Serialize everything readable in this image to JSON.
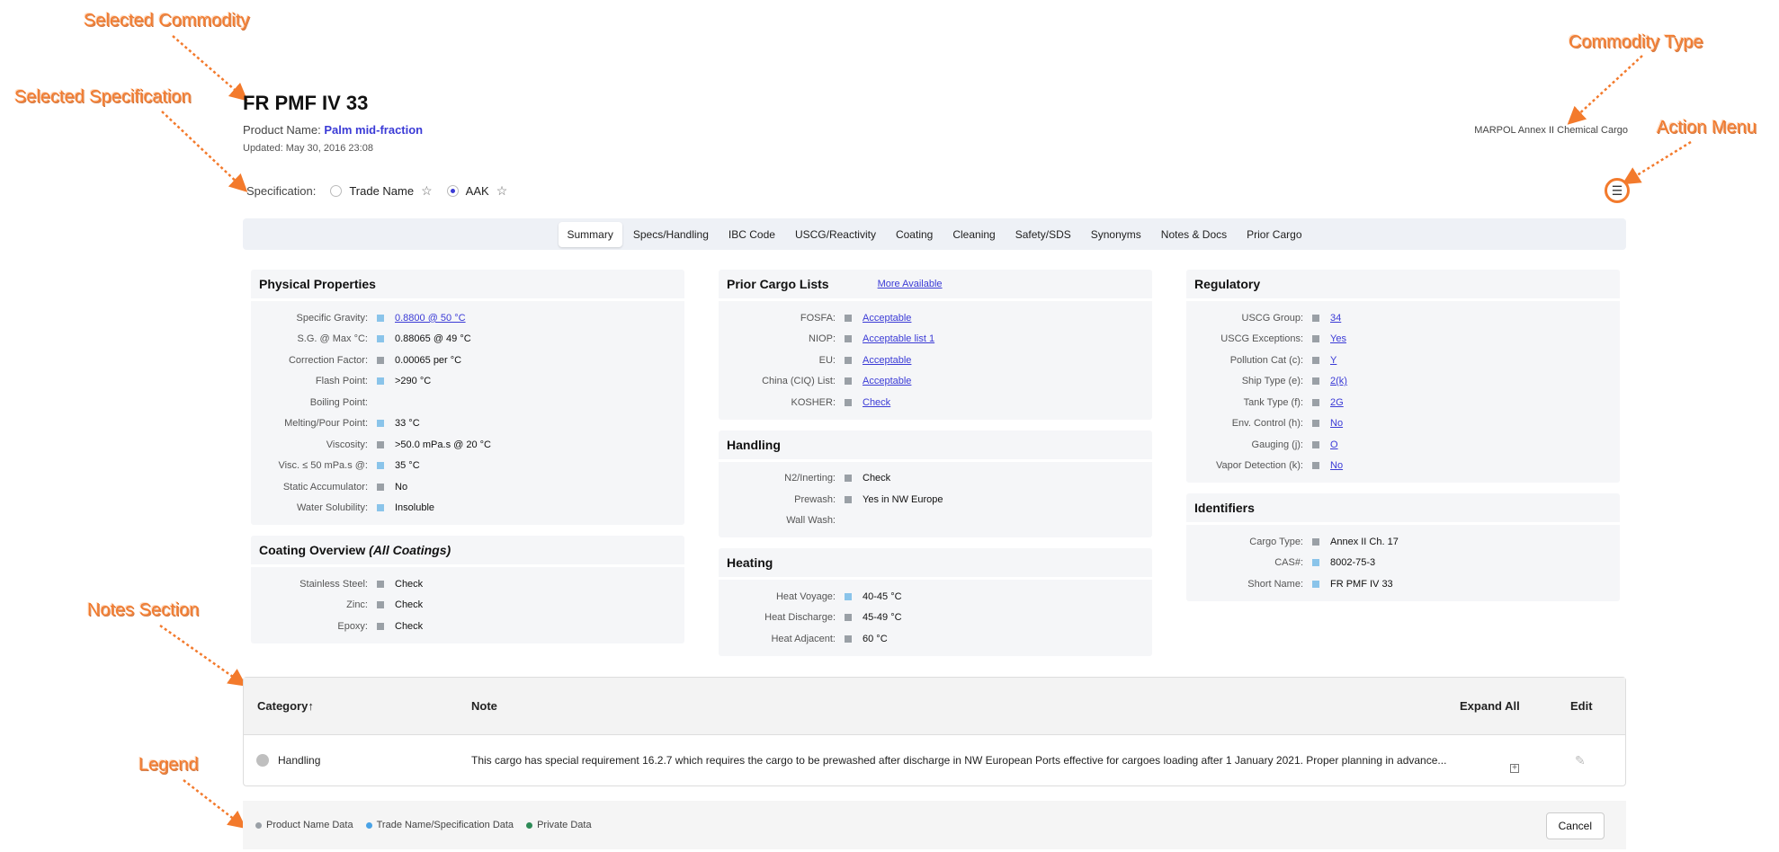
{
  "annotations": {
    "selected_commodity": "Selected Commodity",
    "selected_specification": "Selected Specification",
    "commodity_type": "Commodity Type",
    "action_menu": "Action Menu",
    "notes_section": "Notes Section",
    "legend": "Legend"
  },
  "header": {
    "title": "FR PMF IV 33",
    "product_label": "Product Name:",
    "product_name": "Palm mid-fraction",
    "updated": "Updated: May 30, 2016 23:08",
    "commodity_type": "MARPOL Annex II Chemical Cargo"
  },
  "specification": {
    "label": "Specification:",
    "options": [
      {
        "label": "Trade Name",
        "checked": false
      },
      {
        "label": "AAK",
        "checked": true
      }
    ]
  },
  "action_menu_icon": "hamburger-icon",
  "tabs": [
    "Summary",
    "Specs/Handling",
    "IBC Code",
    "USCG/Reactivity",
    "Coating",
    "Cleaning",
    "Safety/SDS",
    "Synonyms",
    "Notes & Docs",
    "Prior Cargo"
  ],
  "active_tab": "Summary",
  "physical": {
    "title": "Physical Properties",
    "rows": [
      {
        "label": "Specific Gravity:",
        "value": "0.8800 @ 50 °C",
        "src": "blue",
        "link": true
      },
      {
        "label": "S.G. @ Max °C:",
        "value": "0.88065 @ 49 °C",
        "src": "blue",
        "link": false
      },
      {
        "label": "Correction Factor:",
        "value": "0.00065 per °C",
        "src": "gray",
        "link": false
      },
      {
        "label": "Flash Point:",
        "value": ">290 °C",
        "src": "blue",
        "link": false
      },
      {
        "label": "Boiling Point:",
        "value": "",
        "src": "none",
        "link": false
      },
      {
        "label": "Melting/Pour Point:",
        "value": "33 °C",
        "src": "blue",
        "link": false
      },
      {
        "label": "Viscosity:",
        "value": ">50.0 mPa.s @ 20 °C",
        "src": "gray",
        "link": false
      },
      {
        "label": "Visc. ≤ 50 mPa.s @:",
        "value": "35 °C",
        "src": "blue",
        "link": false
      },
      {
        "label": "Static Accumulator:",
        "value": "No",
        "src": "gray",
        "link": false
      },
      {
        "label": "Water Solubility:",
        "value": "Insoluble",
        "src": "blue",
        "link": false
      }
    ]
  },
  "coating": {
    "title": "Coating Overview",
    "title_em": "(All Coatings)",
    "rows": [
      {
        "label": "Stainless Steel:",
        "value": "Check",
        "src": "gray",
        "link": false
      },
      {
        "label": "Zinc:",
        "value": "Check",
        "src": "gray",
        "link": false
      },
      {
        "label": "Epoxy:",
        "value": "Check",
        "src": "gray",
        "link": false
      }
    ]
  },
  "prior_cargo": {
    "title": "Prior Cargo Lists",
    "more": "More Available",
    "rows": [
      {
        "label": "FOSFA:",
        "value": "Acceptable",
        "src": "gray",
        "link": true
      },
      {
        "label": "NIOP:",
        "value": "Acceptable list 1",
        "src": "gray",
        "link": true
      },
      {
        "label": "EU:",
        "value": "Acceptable",
        "src": "gray",
        "link": true
      },
      {
        "label": "China (CIQ) List:",
        "value": "Acceptable",
        "src": "gray",
        "link": true
      },
      {
        "label": "KOSHER:",
        "value": "Check",
        "src": "gray",
        "link": true
      }
    ]
  },
  "handling": {
    "title": "Handling",
    "rows": [
      {
        "label": "N2/Inerting:",
        "value": "Check",
        "src": "gray",
        "link": false
      },
      {
        "label": "Prewash:",
        "value": "Yes in NW Europe",
        "src": "gray",
        "link": false
      },
      {
        "label": "Wall Wash:",
        "value": "",
        "src": "none",
        "link": false
      }
    ]
  },
  "heating": {
    "title": "Heating",
    "rows": [
      {
        "label": "Heat Voyage:",
        "value": "40-45 °C",
        "src": "blue",
        "link": false
      },
      {
        "label": "Heat Discharge:",
        "value": "45-49 °C",
        "src": "gray",
        "link": false
      },
      {
        "label": "Heat Adjacent:",
        "value": "60 °C",
        "src": "gray",
        "link": false
      }
    ]
  },
  "regulatory": {
    "title": "Regulatory",
    "rows": [
      {
        "label": "USCG Group:",
        "value": "34",
        "src": "gray",
        "link": true
      },
      {
        "label": "USCG Exceptions:",
        "value": "Yes",
        "src": "gray",
        "link": true
      },
      {
        "label": "Pollution Cat (c):",
        "value": "Y",
        "src": "gray",
        "link": true
      },
      {
        "label": "Ship Type (e):",
        "value": "2(k)",
        "src": "gray",
        "link": true
      },
      {
        "label": "Tank Type (f):",
        "value": "2G",
        "src": "gray",
        "link": true
      },
      {
        "label": "Env. Control (h):",
        "value": "No",
        "src": "gray",
        "link": true
      },
      {
        "label": "Gauging (j):",
        "value": "O",
        "src": "gray",
        "link": true
      },
      {
        "label": "Vapor Detection (k):",
        "value": "No",
        "src": "gray",
        "link": true
      }
    ]
  },
  "identifiers": {
    "title": "Identifiers",
    "rows": [
      {
        "label": "Cargo Type:",
        "value": "Annex II Ch. 17",
        "src": "gray",
        "link": false
      },
      {
        "label": "CAS#:",
        "value": "8002-75-3",
        "src": "blue",
        "link": false
      },
      {
        "label": "Short Name:",
        "value": "FR PMF IV 33",
        "src": "blue",
        "link": false
      }
    ]
  },
  "notes": {
    "col_category": "Category↑",
    "col_note": "Note",
    "expand_all": "Expand All",
    "edit": "Edit",
    "row": {
      "category": "Handling",
      "text": "This cargo has special requirement 16.2.7 which requires the cargo to be prewashed after discharge in NW European Ports effective for cargoes loading after 1 January 2021. Proper planning in advance..."
    }
  },
  "legend": {
    "items": [
      {
        "label": "Product Name Data",
        "color": "#9aa0a6"
      },
      {
        "label": "Trade Name/Specification Data",
        "color": "#4aa3e6"
      },
      {
        "label": "Private Data",
        "color": "#2e8b57"
      }
    ],
    "cancel": "Cancel"
  },
  "colors": {
    "accent": "#3b3bd6",
    "annotation": "#f37a2c",
    "source_gray": "#9aa0a6",
    "source_blue": "#8ac4ea"
  }
}
